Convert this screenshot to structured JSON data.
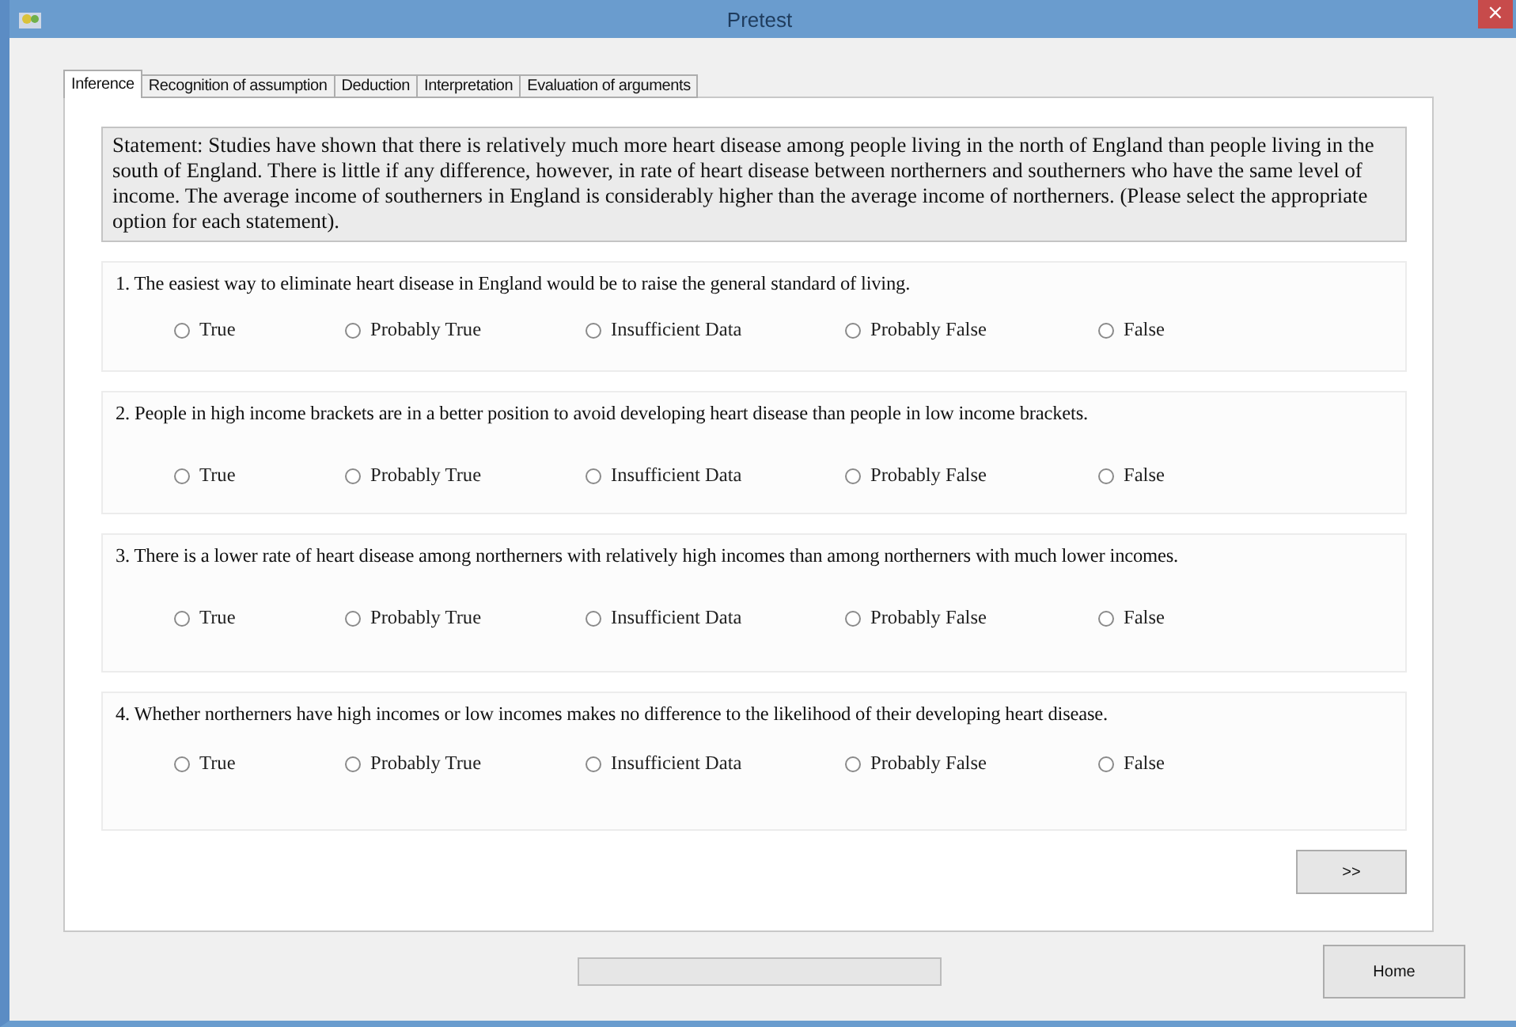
{
  "window": {
    "title": "Pretest",
    "close_label": "×"
  },
  "tabs": [
    {
      "label": "Inference",
      "selected": true
    },
    {
      "label": "Recognition of assumption",
      "selected": false
    },
    {
      "label": "Deduction",
      "selected": false
    },
    {
      "label": "Interpretation",
      "selected": false
    },
    {
      "label": "Evaluation of arguments",
      "selected": false
    }
  ],
  "statement": "Statement: Studies have shown that there is relatively much more heart disease among people living in the north of England than people living in the south of England. There is little if any difference, however, in rate of heart disease between northerners and southerners who have the same level of income. The average income of southerners in England is considerably higher than the average income of northerners. (Please select the appropriate option for each statement).",
  "questions": [
    {
      "text": "1. The easiest way to eliminate heart disease in England would be to raise the general standard of living.",
      "options": [
        {
          "label": "True",
          "selected": false
        },
        {
          "label": "Probably True",
          "selected": false
        },
        {
          "label": "Insufficient Data",
          "selected": false
        },
        {
          "label": "Probably False",
          "selected": false
        },
        {
          "label": "False",
          "selected": false
        }
      ]
    },
    {
      "text": "2. People in high income brackets are in a better position to avoid developing heart disease than people in low income brackets.",
      "options": [
        {
          "label": "True",
          "selected": false
        },
        {
          "label": "Probably True",
          "selected": false
        },
        {
          "label": "Insufficient Data",
          "selected": false
        },
        {
          "label": "Probably False",
          "selected": false
        },
        {
          "label": "False",
          "selected": false
        }
      ]
    },
    {
      "text": "3. There is a lower rate of heart disease among northerners with relatively high incomes than among northerners with much lower incomes.",
      "options": [
        {
          "label": "True",
          "selected": false
        },
        {
          "label": "Probably True",
          "selected": false
        },
        {
          "label": "Insufficient Data",
          "selected": false
        },
        {
          "label": "Probably False",
          "selected": false
        },
        {
          "label": "False",
          "selected": false
        }
      ]
    },
    {
      "text": "4. Whether northerners have high incomes or low incomes makes no difference to the likelihood of their developing heart disease.",
      "options": [
        {
          "label": "True",
          "selected": false
        },
        {
          "label": "Probably True",
          "selected": false
        },
        {
          "label": "Insufficient Data",
          "selected": false
        },
        {
          "label": "Probably False",
          "selected": false
        },
        {
          "label": "False",
          "selected": false
        }
      ]
    }
  ],
  "next_button": ">>",
  "progress": {
    "level": 0
  },
  "home_button": "Home"
}
